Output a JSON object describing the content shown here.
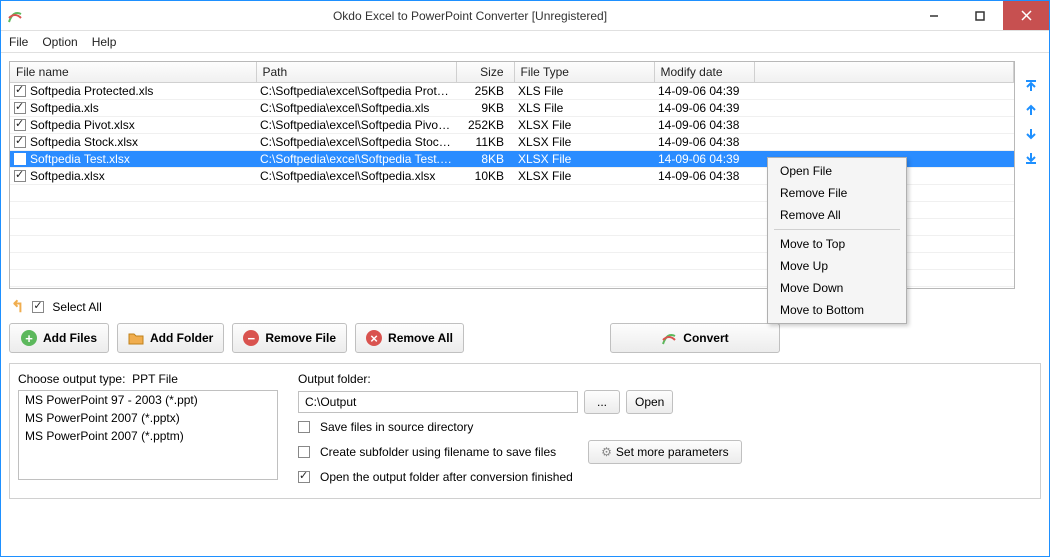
{
  "window": {
    "title": "Okdo Excel to PowerPoint Converter [Unregistered]"
  },
  "menu": {
    "file": "File",
    "option": "Option",
    "help": "Help"
  },
  "columns": {
    "name": "File name",
    "path": "Path",
    "size": "Size",
    "type": "File Type",
    "date": "Modify date"
  },
  "files": [
    {
      "checked": true,
      "name": "Softpedia Protected.xls",
      "path": "C:\\Softpedia\\excel\\Softpedia Protect...",
      "size": "25KB",
      "type": "XLS File",
      "date": "14-09-06 04:39"
    },
    {
      "checked": true,
      "name": "Softpedia.xls",
      "path": "C:\\Softpedia\\excel\\Softpedia.xls",
      "size": "9KB",
      "type": "XLS File",
      "date": "14-09-06 04:39"
    },
    {
      "checked": true,
      "name": "Softpedia Pivot.xlsx",
      "path": "C:\\Softpedia\\excel\\Softpedia Pivot.xlsx",
      "size": "252KB",
      "type": "XLSX File",
      "date": "14-09-06 04:38"
    },
    {
      "checked": true,
      "name": "Softpedia Stock.xlsx",
      "path": "C:\\Softpedia\\excel\\Softpedia Stock.xl...",
      "size": "11KB",
      "type": "XLSX File",
      "date": "14-09-06 04:38"
    },
    {
      "checked": true,
      "name": "Softpedia Test.xlsx",
      "path": "C:\\Softpedia\\excel\\Softpedia Test.xlsx",
      "size": "8KB",
      "type": "XLSX File",
      "date": "14-09-06 04:39",
      "selected": true
    },
    {
      "checked": true,
      "name": "Softpedia.xlsx",
      "path": "C:\\Softpedia\\excel\\Softpedia.xlsx",
      "size": "10KB",
      "type": "XLSX File",
      "date": "14-09-06 04:38"
    }
  ],
  "toolbar": {
    "select_all": "Select All",
    "add_files": "Add Files",
    "add_folder": "Add Folder",
    "remove_file": "Remove File",
    "remove_all": "Remove All",
    "convert": "Convert"
  },
  "output_type": {
    "label": "Choose output type:",
    "current": "PPT File",
    "options": [
      "MS PowerPoint 97 - 2003 (*.ppt)",
      "MS PowerPoint 2007 (*.pptx)",
      "MS PowerPoint 2007 (*.pptm)"
    ]
  },
  "output_folder": {
    "label": "Output folder:",
    "value": "C:\\Output",
    "browse": "...",
    "open": "Open",
    "save_source": "Save files in source directory",
    "create_subfolder": "Create subfolder using filename to save files",
    "open_after": "Open the output folder after conversion finished",
    "save_source_checked": false,
    "create_subfolder_checked": false,
    "open_after_checked": true,
    "more_params": "Set more parameters"
  },
  "context_menu": {
    "open_file": "Open File",
    "remove_file": "Remove File",
    "remove_all": "Remove All",
    "move_top": "Move to Top",
    "move_up": "Move Up",
    "move_down": "Move Down",
    "move_bottom": "Move to Bottom"
  }
}
